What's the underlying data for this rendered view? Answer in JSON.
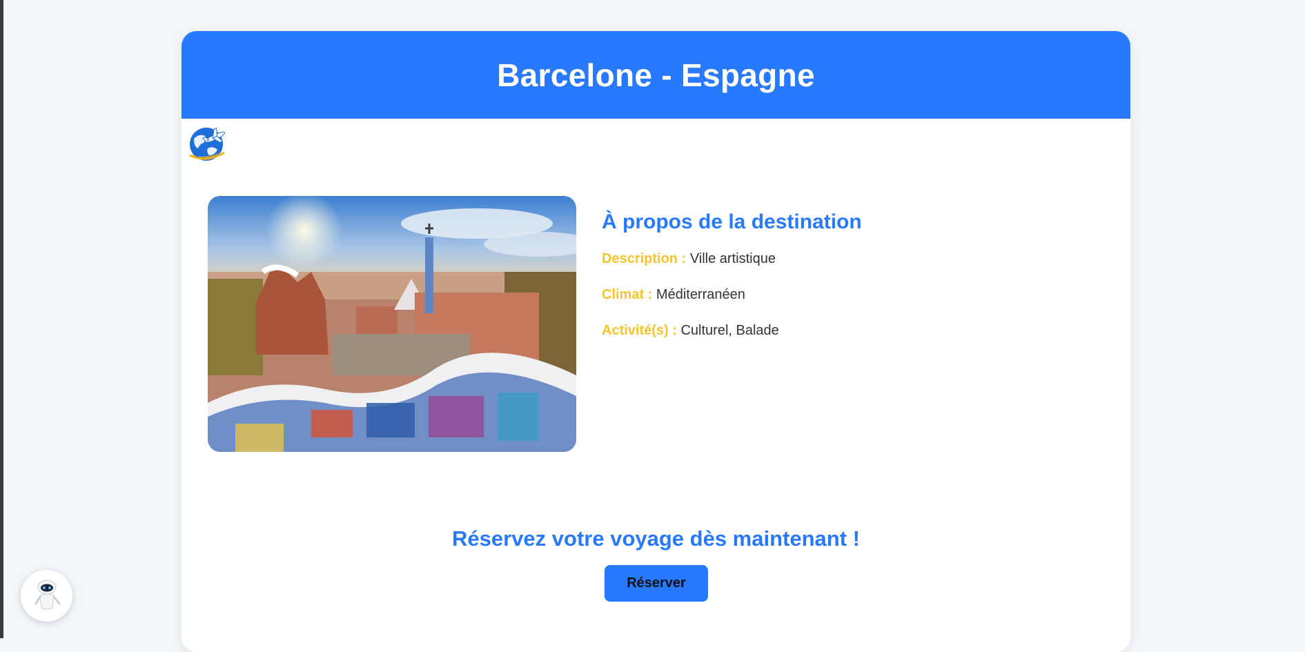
{
  "header": {
    "title": "Barcelone - Espagne"
  },
  "logo": {
    "icon": "globe-plane-logo-icon"
  },
  "destination": {
    "image_alt": "Park Güell, Barcelone",
    "section_title": "À propos de la destination",
    "description_label": "Description :",
    "description_value": "Ville artistique",
    "climate_label": "Climat :",
    "climate_value": "Méditerranéen",
    "activities_label": "Activité(s) :",
    "activities_value": "Culturel, Balade"
  },
  "cta": {
    "title": "Réservez votre voyage dès maintenant !",
    "button_label": "Réserver"
  },
  "chatbot": {
    "icon": "robot-assistant-icon"
  },
  "colors": {
    "primary": "#2979ff",
    "label_yellow": "#f6c42c",
    "page_bg": "#f3f6fb"
  }
}
